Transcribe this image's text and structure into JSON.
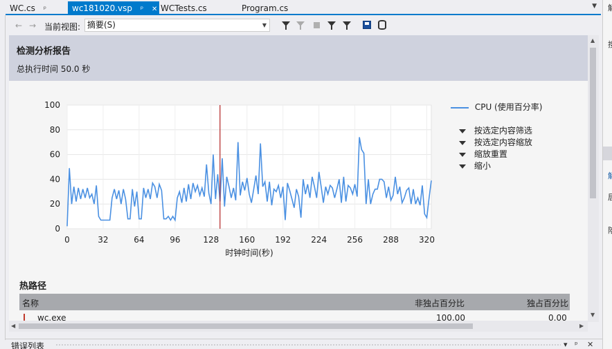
{
  "tabs": [
    {
      "label": "WC.cs",
      "pin": "ᵖ",
      "active": false
    },
    {
      "label": "wc181020.vsp",
      "pin": "ᵖ",
      "close": "✕",
      "active": true
    },
    {
      "label": "WCTests.cs",
      "active": false
    },
    {
      "label": "Program.cs",
      "active": false
    }
  ],
  "toolbar": {
    "current_view_label": "当前视图:",
    "current_view_value": "摘要(S)"
  },
  "report": {
    "title": "检测分析报告",
    "total_time": "总执行时间 50.0 秒"
  },
  "legend": {
    "series": "CPU (使用百分率)",
    "actions": [
      "按选定内容筛选",
      "按选定内容缩放",
      "缩放重置",
      "缩小"
    ]
  },
  "chart_data": {
    "type": "line",
    "xlabel": "时钟时间(秒)",
    "xlim": [
      0,
      324
    ],
    "ylim": [
      0,
      100
    ],
    "xticks": [
      0,
      32,
      64,
      96,
      128,
      160,
      192,
      224,
      256,
      288,
      320
    ],
    "yticks": [
      0,
      20,
      40,
      60,
      80,
      100
    ],
    "marker_x": 136,
    "marker_color": "#b22222",
    "series": [
      {
        "color": "#4a90e2",
        "x": [
          0,
          2,
          4,
          6,
          8,
          10,
          12,
          14,
          16,
          18,
          20,
          22,
          24,
          26,
          28,
          30,
          32,
          34,
          36,
          38,
          40,
          42,
          44,
          46,
          48,
          50,
          52,
          54,
          56,
          58,
          60,
          62,
          64,
          66,
          68,
          70,
          72,
          74,
          76,
          78,
          80,
          82,
          84,
          86,
          88,
          90,
          92,
          94,
          96,
          98,
          100,
          102,
          104,
          106,
          108,
          110,
          112,
          114,
          116,
          118,
          120,
          122,
          124,
          126,
          128,
          130,
          132,
          134,
          136,
          138,
          140,
          142,
          144,
          146,
          148,
          150,
          152,
          154,
          156,
          158,
          160,
          162,
          164,
          166,
          168,
          170,
          172,
          174,
          176,
          178,
          180,
          182,
          184,
          186,
          188,
          190,
          192,
          194,
          196,
          198,
          200,
          202,
          204,
          206,
          208,
          210,
          212,
          214,
          216,
          218,
          220,
          222,
          224,
          226,
          228,
          230,
          232,
          234,
          236,
          238,
          240,
          242,
          244,
          246,
          248,
          250,
          252,
          254,
          256,
          258,
          260,
          262,
          264,
          266,
          268,
          270,
          272,
          274,
          276,
          278,
          280,
          282,
          284,
          286,
          288,
          290,
          292,
          294,
          296,
          298,
          300,
          302,
          304,
          306,
          308,
          310,
          312,
          314,
          316,
          318,
          320,
          322,
          324
        ],
        "y": [
          2,
          49,
          20,
          34,
          22,
          33,
          24,
          32,
          25,
          33,
          25,
          28,
          20,
          35,
          10,
          7,
          7,
          7,
          7,
          7,
          25,
          32,
          24,
          31,
          20,
          32,
          24,
          8,
          8,
          32,
          18,
          30,
          8,
          8,
          33,
          25,
          32,
          24,
          37,
          34,
          25,
          36,
          31,
          8,
          8,
          10,
          7,
          10,
          7,
          25,
          30,
          21,
          33,
          22,
          36,
          24,
          37,
          30,
          35,
          27,
          33,
          26,
          52,
          29,
          20,
          60,
          24,
          44,
          22,
          57,
          18,
          42,
          34,
          25,
          33,
          23,
          70,
          27,
          38,
          31,
          41,
          28,
          21,
          32,
          43,
          28,
          69,
          34,
          38,
          22,
          38,
          19,
          32,
          30,
          35,
          25,
          34,
          7,
          37,
          31,
          24,
          17,
          32,
          26,
          9,
          40,
          28,
          36,
          25,
          42,
          34,
          25,
          46,
          34,
          21,
          34,
          28,
          35,
          33,
          25,
          32,
          40,
          21,
          42,
          22,
          35,
          33,
          28,
          36,
          26,
          74,
          64,
          61,
          20,
          40,
          20,
          28,
          32,
          32,
          40,
          40,
          38,
          25,
          34,
          23,
          27,
          42,
          28,
          34,
          21,
          25,
          31,
          33,
          20,
          32,
          20,
          25,
          19,
          35,
          12,
          9,
          25,
          39
        ]
      }
    ]
  },
  "hot_path": {
    "title": "热路径",
    "headers": [
      "名称",
      "非独占百分比",
      "独占百分比"
    ],
    "rows": [
      {
        "name": "wc.exe",
        "inclusive": "100.00",
        "exclusive": "0.00"
      }
    ]
  },
  "bottom_panel": {
    "title": "错误列表"
  },
  "right_panel": {
    "fragments": [
      "解",
      "搜",
      "解",
      "居",
      "陪"
    ]
  },
  "colors": {
    "accent": "#007acc",
    "header_band": "#cfd2de",
    "cpu_line": "#4a90e2"
  }
}
